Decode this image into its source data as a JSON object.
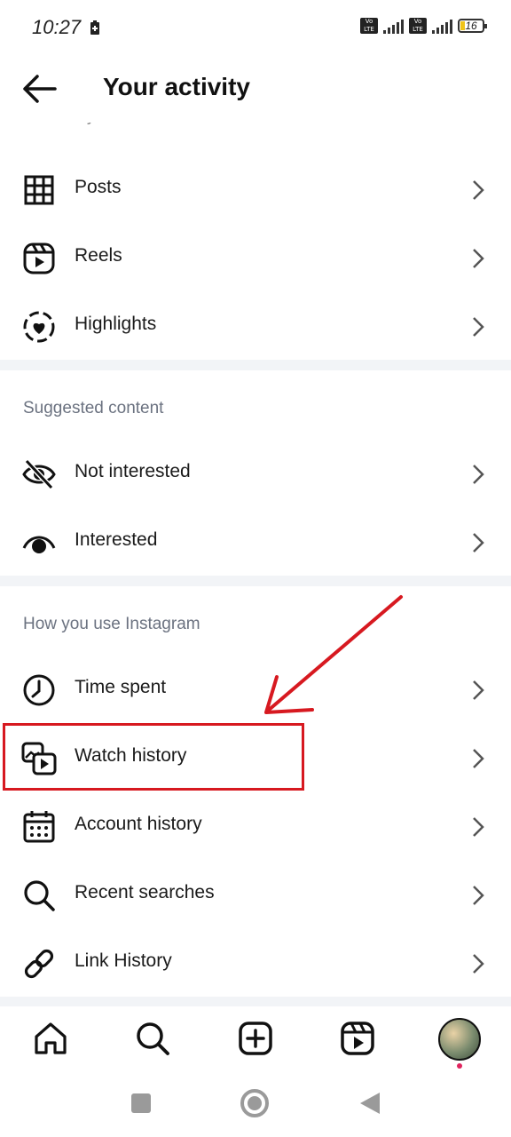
{
  "status_bar": {
    "time": "10:27",
    "sim1": "Vo LTE",
    "network": "4G",
    "sim2": "Vo LTE",
    "battery": "16"
  },
  "header": {
    "title": "Your activity",
    "back_icon": "arrow-left-icon"
  },
  "sections": {
    "content_shared": {
      "title": "Content you shared",
      "items": [
        {
          "label": "Posts",
          "icon": "grid-icon"
        },
        {
          "label": "Reels",
          "icon": "reels-icon"
        },
        {
          "label": "Highlights",
          "icon": "highlights-icon"
        }
      ]
    },
    "suggested": {
      "title": "Suggested content",
      "items": [
        {
          "label": "Not interested",
          "icon": "eye-off-icon"
        },
        {
          "label": "Interested",
          "icon": "eye-icon"
        }
      ]
    },
    "usage": {
      "title": "How you use Instagram",
      "items": [
        {
          "label": "Time spent",
          "icon": "clock-icon"
        },
        {
          "label": "Watch history",
          "icon": "watch-history-icon"
        },
        {
          "label": "Account history",
          "icon": "calendar-icon"
        },
        {
          "label": "Recent searches",
          "icon": "search-icon"
        },
        {
          "label": "Link History",
          "icon": "link-icon"
        }
      ]
    }
  },
  "bottom_nav": [
    "home-icon",
    "search-icon",
    "create-icon",
    "reels-icon",
    "profile-avatar"
  ],
  "system_nav": [
    "recents-icon",
    "home-circle-icon",
    "back-triangle-icon"
  ],
  "colors": {
    "annotation": "#d71920",
    "section_title": "#6b7280",
    "divider": "#f2f4f7"
  }
}
